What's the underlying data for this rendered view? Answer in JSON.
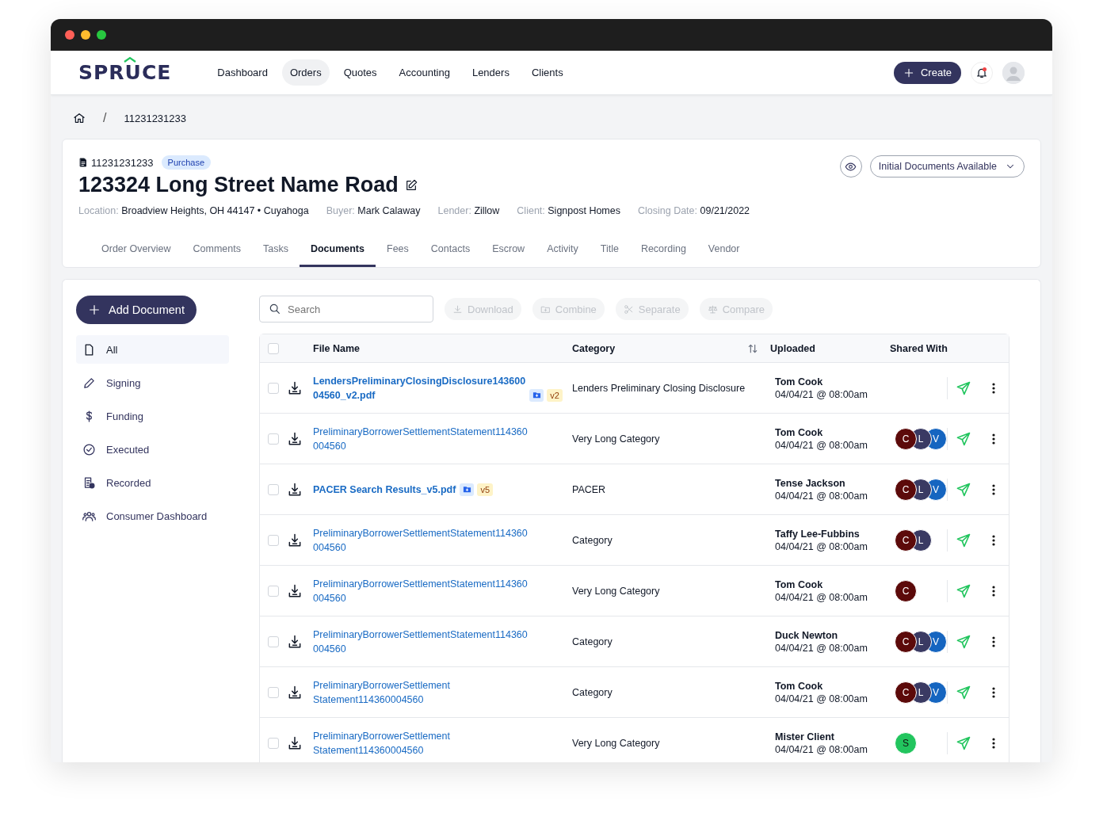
{
  "logo": "SPRUCE",
  "nav": [
    {
      "label": "Dashboard",
      "selected": false
    },
    {
      "label": "Orders",
      "selected": true
    },
    {
      "label": "Quotes",
      "selected": false
    },
    {
      "label": "Accounting",
      "selected": false
    },
    {
      "label": "Lenders",
      "selected": false
    },
    {
      "label": "Clients",
      "selected": false
    }
  ],
  "create_button": "Create",
  "notifications": {
    "unread": true
  },
  "breadcrumb_separator": "/",
  "breadcrumb": [
    "11231231233"
  ],
  "order": {
    "number": "11231231233",
    "type_badge": "Purchase",
    "title": "123324 Long Street Name Road",
    "meta": [
      {
        "label": "Location:",
        "value": "Broadview Heights, OH 44147 • Cuyahoga"
      },
      {
        "label": "Buyer:",
        "value": "Mark Calaway"
      },
      {
        "label": "Lender:",
        "value": "Zillow"
      },
      {
        "label": "Client:",
        "value": "Signpost Homes"
      },
      {
        "label": "Closing Date:",
        "value": "09/21/2022"
      }
    ],
    "status": "Initial Documents Available"
  },
  "tabs": [
    {
      "label": "Order Overview",
      "selected": false
    },
    {
      "label": "Comments",
      "selected": false
    },
    {
      "label": "Tasks",
      "selected": false
    },
    {
      "label": "Documents",
      "selected": true
    },
    {
      "label": "Fees",
      "selected": false
    },
    {
      "label": "Contacts",
      "selected": false
    },
    {
      "label": "Escrow",
      "selected": false
    },
    {
      "label": "Activity",
      "selected": false
    },
    {
      "label": "Title",
      "selected": false
    },
    {
      "label": "Recording",
      "selected": false
    },
    {
      "label": "Vendor",
      "selected": false
    }
  ],
  "add_document": "Add Document",
  "sidebar": {
    "items": [
      {
        "kind": "all",
        "label": "All",
        "selected": true
      },
      {
        "kind": "signing",
        "label": "Signing",
        "selected": false
      },
      {
        "kind": "funding",
        "label": "Funding",
        "selected": false
      },
      {
        "kind": "executed",
        "label": "Executed",
        "selected": false
      },
      {
        "kind": "recorded",
        "label": "Recorded",
        "selected": false
      },
      {
        "kind": "consumer",
        "label": "Consumer Dashboard",
        "selected": false
      }
    ]
  },
  "search": {
    "placeholder": "Search"
  },
  "actions": [
    {
      "kind": "download",
      "label": "Download",
      "disabled": true
    },
    {
      "kind": "combine",
      "label": "Combine",
      "disabled": true
    },
    {
      "kind": "separate",
      "label": "Separate",
      "disabled": true
    },
    {
      "kind": "compare",
      "label": "Compare",
      "disabled": true
    }
  ],
  "table": {
    "select_all_checked": false,
    "columns": [
      "File Name",
      "Category",
      "Uploaded",
      "Shared With"
    ],
    "rows": [
      {
        "file_name": [
          "LendersPreliminaryClosingDisclosure143600",
          "04560_v2.pdf"
        ],
        "bold": true,
        "version": "v2",
        "category": "Lenders Preliminary Closing Disclosure",
        "uploader": "Tom Cook",
        "date": "04/04/21 @ 08:00am",
        "shared": [],
        "checked": false
      },
      {
        "file_name": [
          "PreliminaryBorrowerSettlementStatement114360",
          "004560"
        ],
        "bold": false,
        "category": "Very Long Category",
        "uploader": "Tom Cook",
        "date": "04/04/21 @ 08:00am",
        "shared": [
          {
            "initial": "C",
            "color": "#5c0a0a"
          },
          {
            "initial": "L",
            "color": "#3a3a63"
          },
          {
            "initial": "V",
            "color": "#1565c0"
          }
        ],
        "checked": false
      },
      {
        "file_name": [
          "PACER Search Results_v5.pdf"
        ],
        "bold": true,
        "version": "v5",
        "category": "PACER",
        "uploader": "Tense Jackson",
        "date": "04/04/21 @ 08:00am",
        "shared": [
          {
            "initial": "C",
            "color": "#5c0a0a"
          },
          {
            "initial": "L",
            "color": "#3a3a63"
          },
          {
            "initial": "V",
            "color": "#1565c0"
          }
        ],
        "checked": false
      },
      {
        "file_name": [
          "PreliminaryBorrowerSettlementStatement114360",
          "004560"
        ],
        "bold": false,
        "category": "Category",
        "uploader": "Taffy Lee-Fubbins",
        "date": "04/04/21 @ 08:00am",
        "shared": [
          {
            "initial": "C",
            "color": "#5c0a0a"
          },
          {
            "initial": "L",
            "color": "#3a3a63"
          }
        ],
        "checked": false
      },
      {
        "file_name": [
          "PreliminaryBorrowerSettlementStatement114360",
          "004560"
        ],
        "bold": false,
        "category": "Very Long Category",
        "uploader": "Tom Cook",
        "date": "04/04/21 @ 08:00am",
        "shared": [
          {
            "initial": "C",
            "color": "#5c0a0a"
          }
        ],
        "checked": false
      },
      {
        "file_name": [
          "PreliminaryBorrowerSettlementStatement114360",
          "004560"
        ],
        "bold": false,
        "category": "Category",
        "uploader": "Duck Newton",
        "date": "04/04/21 @ 08:00am",
        "shared": [
          {
            "initial": "C",
            "color": "#5c0a0a"
          },
          {
            "initial": "L",
            "color": "#3a3a63"
          },
          {
            "initial": "V",
            "color": "#1565c0"
          }
        ],
        "checked": false
      },
      {
        "file_name": [
          "PreliminaryBorrowerSettlement",
          "Statement114360004560"
        ],
        "bold": false,
        "category": "Category",
        "uploader": "Tom Cook",
        "date": "04/04/21 @ 08:00am",
        "shared": [
          {
            "initial": "C",
            "color": "#5c0a0a"
          },
          {
            "initial": "L",
            "color": "#3a3a63"
          },
          {
            "initial": "V",
            "color": "#1565c0"
          }
        ],
        "checked": false
      },
      {
        "file_name": [
          "PreliminaryBorrowerSettlement",
          "Statement114360004560"
        ],
        "bold": false,
        "category": "Very Long Category",
        "uploader": "Mister Client",
        "date": "04/04/21 @ 08:00am",
        "shared": [
          {
            "initial": "S",
            "color": "#22c55e"
          }
        ],
        "checked": false
      }
    ]
  }
}
